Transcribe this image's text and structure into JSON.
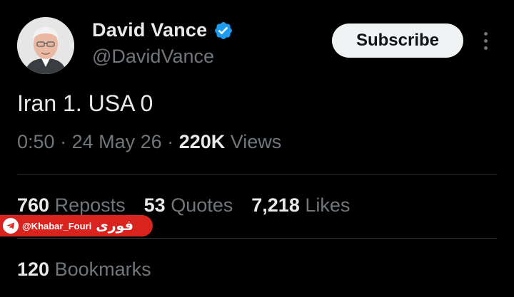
{
  "profile": {
    "display_name": "David Vance",
    "handle": "@DavidVance",
    "verified": true
  },
  "actions": {
    "subscribe_label": "Subscribe"
  },
  "tweet": {
    "text": "Iran 1. USA 0",
    "time": "0:50",
    "date": "24 May 26",
    "views_count": "220K",
    "views_label": "Views",
    "separator": "·"
  },
  "stats": {
    "reposts": {
      "count": "760",
      "label": "Reposts"
    },
    "quotes": {
      "count": "53",
      "label": "Quotes"
    },
    "likes": {
      "count": "7,218",
      "label": "Likes"
    },
    "bookmarks": {
      "count": "120",
      "label": "Bookmarks"
    }
  },
  "watermark": {
    "handle": "@Khabar_Fouri",
    "logo_text": "فوری"
  },
  "colors": {
    "background": "#000000",
    "primary_text": "#e7e9ea",
    "secondary_text": "#71767b",
    "verified_badge": "#1d9bf0",
    "divider": "#2f3336",
    "watermark": "#d8231e"
  }
}
